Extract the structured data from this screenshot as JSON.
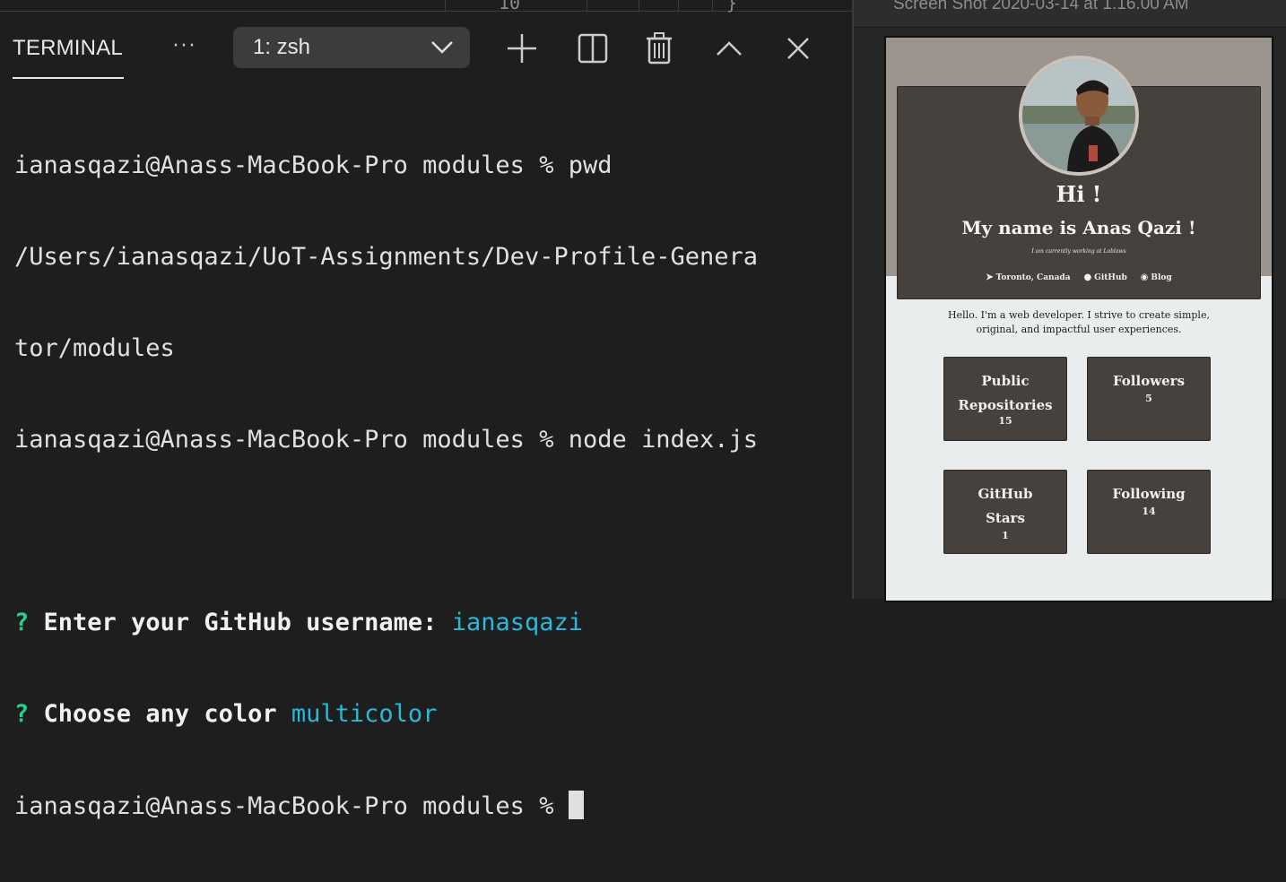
{
  "terminal": {
    "tab_label": "TERMINAL",
    "more_label": "···",
    "shell_select": "1: zsh",
    "top_fragments": [
      "10",
      "}"
    ],
    "lines": {
      "l1": "ianasqazi@Anass-MacBook-Pro modules % pwd",
      "l2": "/Users/ianasqazi/UoT-Assignments/Dev-Profile-Genera",
      "l3": "tor/modules",
      "l4": "ianasqazi@Anass-MacBook-Pro modules % node index.js",
      "l5_mark": "?",
      "l5_prompt": "Enter your GitHub username:",
      "l5_answer": "ianasqazi",
      "l6_mark": "?",
      "l6_prompt": "Choose any color",
      "l6_answer": "multicolor",
      "l7": "ianasqazi@Anass-MacBook-Pro modules % "
    },
    "icons": [
      "plus-icon",
      "split-icon",
      "trash-icon",
      "chevron-up-icon",
      "close-icon"
    ],
    "colors": {
      "background": "#1e1e1e",
      "prompt_mark": "#23d18b",
      "answer": "#29b8db"
    }
  },
  "viewer": {
    "window_title": "Screen Shot 2020-03-14 at 1.16.00 AM",
    "profile": {
      "greeting": "Hi !",
      "name": "My name is Anas Qazi !",
      "working": "I am currently working at Loblaws",
      "links": {
        "location": "Toronto, Canada",
        "github": "GitHub",
        "blog": "Blog"
      },
      "bio_line1": "Hello. I'm a web developer. I strive to create simple,",
      "bio_line2": "original, and impactful user experiences.",
      "stats": [
        {
          "label1": "Public",
          "label2": "Repositories",
          "value": "15"
        },
        {
          "label1": "Followers",
          "label2": "",
          "value": "5"
        },
        {
          "label1": "GitHub",
          "label2": "Stars",
          "value": "1"
        },
        {
          "label1": "Following",
          "label2": "",
          "value": "14"
        }
      ]
    }
  }
}
